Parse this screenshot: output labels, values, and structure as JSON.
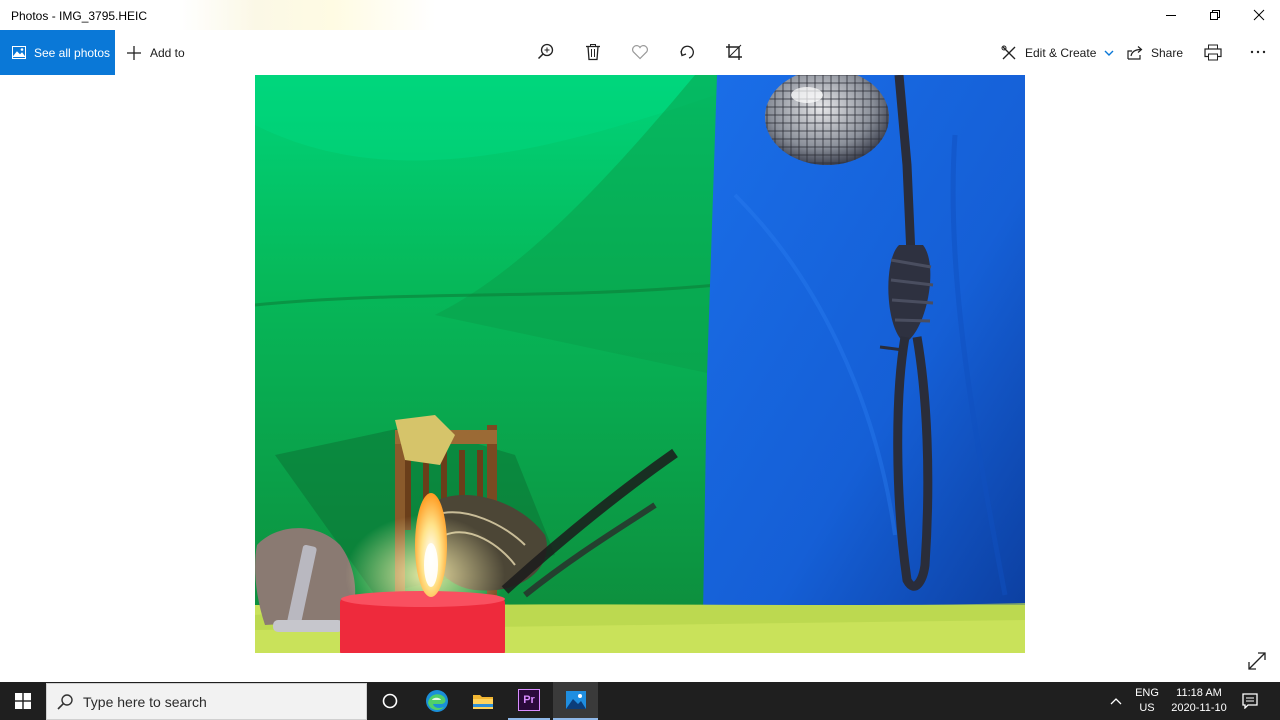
{
  "window": {
    "title": "Photos - IMG_3795.HEIC"
  },
  "toolbar": {
    "see_all_photos": "See all photos",
    "add_to": "Add to",
    "edit_create": "Edit & Create",
    "share": "Share",
    "icons": [
      "zoom-icon",
      "delete-icon",
      "favorite-icon",
      "rotate-icon",
      "crop-icon",
      "print-icon",
      "more-icon"
    ]
  },
  "colors": {
    "accent": "#0a78d7",
    "taskbar": "#1f1f1f"
  },
  "taskbar": {
    "search_placeholder": "Type here to search",
    "language_line1": "ENG",
    "language_line2": "US",
    "time": "11:18 AM",
    "date": "2020-11-10",
    "apps": [
      "task-view",
      "edge",
      "file-explorer",
      "premiere-pro",
      "photos"
    ],
    "premiere_label": "Pr"
  }
}
